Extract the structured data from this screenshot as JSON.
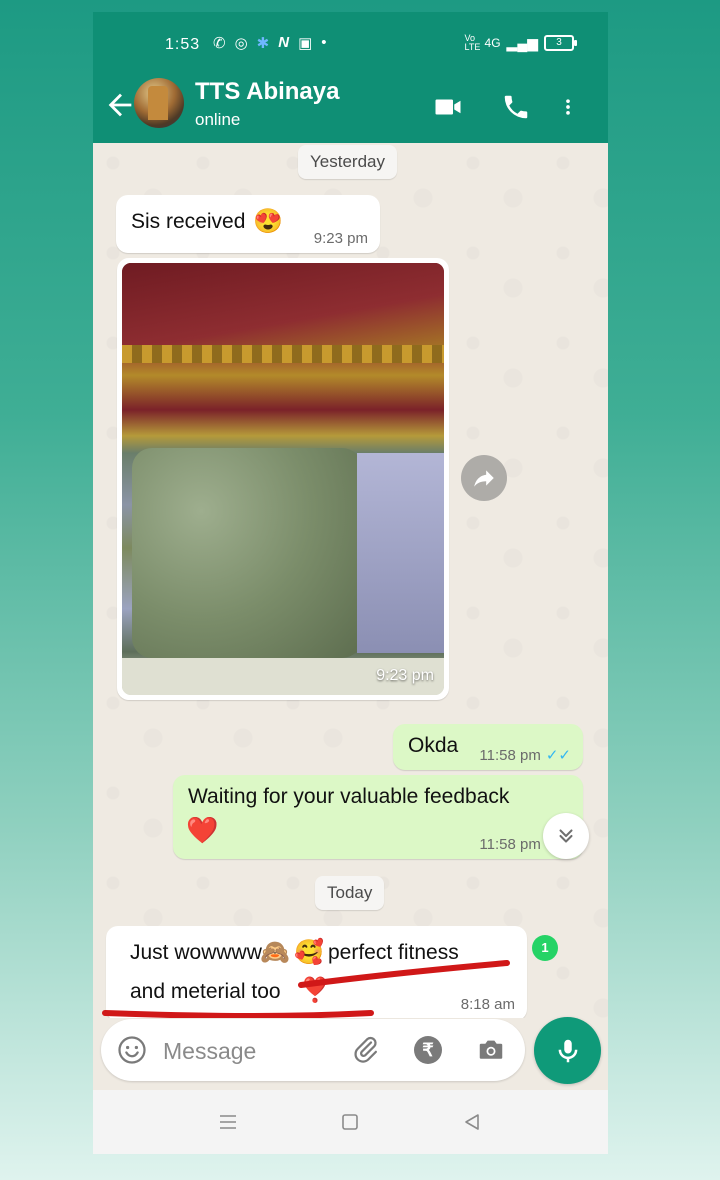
{
  "status_bar": {
    "time": "1:53",
    "network": "4G",
    "volte": "Vo LTE",
    "battery": "3"
  },
  "header": {
    "contact_name": "TTS Abinaya",
    "contact_status": "online"
  },
  "chat": {
    "day_yesterday": "Yesterday",
    "day_today": "Today",
    "messages": [
      {
        "text": "Sis received",
        "emoji": "😍",
        "time": "9:23 pm"
      },
      {
        "photo_time": "9:23 pm"
      },
      {
        "text": "Okda",
        "time": "11:58 pm",
        "ticks": "✓✓"
      },
      {
        "text_line1": "Waiting for your valuable feedback",
        "emoji": "❤️",
        "time": "11:58 pm",
        "ticks": "✓✓"
      },
      {
        "text_part1": "Just wowwww",
        "emoji1": "🙈",
        "emoji2": "🥰",
        "text_part2": "perfect fitness",
        "text_line2": "and meterial too",
        "emoji3": "❣️",
        "time": "8:18 am"
      }
    ],
    "unread_count": "1"
  },
  "input": {
    "placeholder": "Message"
  },
  "colors": {
    "header": "#0f8f75",
    "outgoing_bubble": "#dcf8c6",
    "incoming_bubble": "#ffffff",
    "ticks": "#34b7f1",
    "mic_button": "#0f9a79",
    "unread_badge": "#25d366",
    "annotation_red": "#d01818"
  },
  "icons": {
    "back": "arrow-left-icon",
    "video": "video-camera-icon",
    "call": "phone-icon",
    "menu": "more-vertical-icon",
    "emoji": "emoji-icon",
    "attach": "paperclip-icon",
    "payment": "rupee-icon",
    "camera": "camera-icon",
    "mic": "microphone-icon",
    "forward": "forward-icon",
    "scroll_down": "double-chevron-down-icon"
  }
}
